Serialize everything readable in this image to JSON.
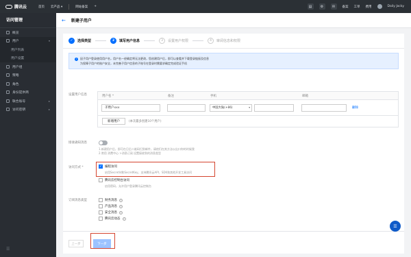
{
  "topbar": {
    "brand": "腾讯云",
    "nav": [
      "首页",
      "云产品",
      "▾",
      "网站备案",
      "+"
    ],
    "right": [
      "备案",
      "工单",
      "费用"
    ],
    "user_name": "Daily Jacky"
  },
  "sidebar": {
    "title": "访问管理",
    "items": [
      {
        "label": "概览",
        "sub": false,
        "chev": ""
      },
      {
        "label": "用户",
        "sub": false,
        "chev": "▾"
      },
      {
        "label": "用户列表",
        "sub": true,
        "chev": ""
      },
      {
        "label": "用户设置",
        "sub": true,
        "chev": ""
      },
      {
        "label": "用户组",
        "sub": false,
        "chev": ""
      },
      {
        "label": "策略",
        "sub": false,
        "chev": ""
      },
      {
        "label": "角色",
        "sub": false,
        "chev": ""
      },
      {
        "label": "身份提供商",
        "sub": false,
        "chev": ""
      },
      {
        "label": "联合账号",
        "sub": false,
        "chev": "▸"
      },
      {
        "label": "访问密钥",
        "sub": false,
        "chev": "▸"
      }
    ],
    "footer_icon": "☰"
  },
  "header": {
    "back_icon": "←",
    "title": "新建子用户"
  },
  "steps": [
    {
      "num": "✓",
      "label": "选择类型",
      "state": "done"
    },
    {
      "num": "2",
      "label": "填写用户信息",
      "state": "current"
    },
    {
      "num": "3",
      "label": "设置用户权限",
      "state": "todo"
    },
    {
      "num": "4",
      "label": "审阅信息和权限",
      "state": "todo"
    }
  ],
  "notice": {
    "line1": "因子用户登录使用用户名，用户名一经确定将无法更改，您创建用户后，即可以查看并下载登录链接及信息",
    "line2": "为保障子用户的账户安全，未完善子用户信息的子账号在登录时需要求确定完成验证手机"
  },
  "form": {
    "user_info_label": "设置用户信息",
    "columns": [
      "用户名 *",
      "备注",
      "手机",
      "邮箱"
    ],
    "row": {
      "username": "子用户xxx",
      "remark": "",
      "phone_region": "中国大陆(+86)",
      "phone": "",
      "email": "",
      "delete": "删除"
    },
    "add_button": "新增用户",
    "add_hint": "(本次最多创建10个用户)",
    "email_notice_label": "接收通知消息",
    "email_notice_hint1": "1.新建用户后，即可在日后二维码扫到邮件，请他们在其方法以出口你的时候我",
    "email_notice_hint2": "2.常用 消费中心 >消息订阅 设置接收到的消息类型",
    "access_label": "访问方式 *",
    "access_programmatic": "编程访问",
    "access_programmatic_hint": "启用SecretId和SecretKey，支持腾讯云API、SDK和其他开发工具访问",
    "access_console": "腾讯云控制台访问",
    "access_console_hint": "启用密码，允许用户登录腾讯云控制台",
    "msg_type_label": "订阅消息类型",
    "msg_types": [
      "财务消息",
      "产品消息",
      "安全消息",
      "腾讯云动态"
    ]
  },
  "footer": {
    "prev": "上一步",
    "next": "下一步"
  },
  "colors": {
    "accent": "#006eff",
    "highlight": "#d4442e",
    "topbar": "#2b3035",
    "sidebar": "#292d33"
  }
}
